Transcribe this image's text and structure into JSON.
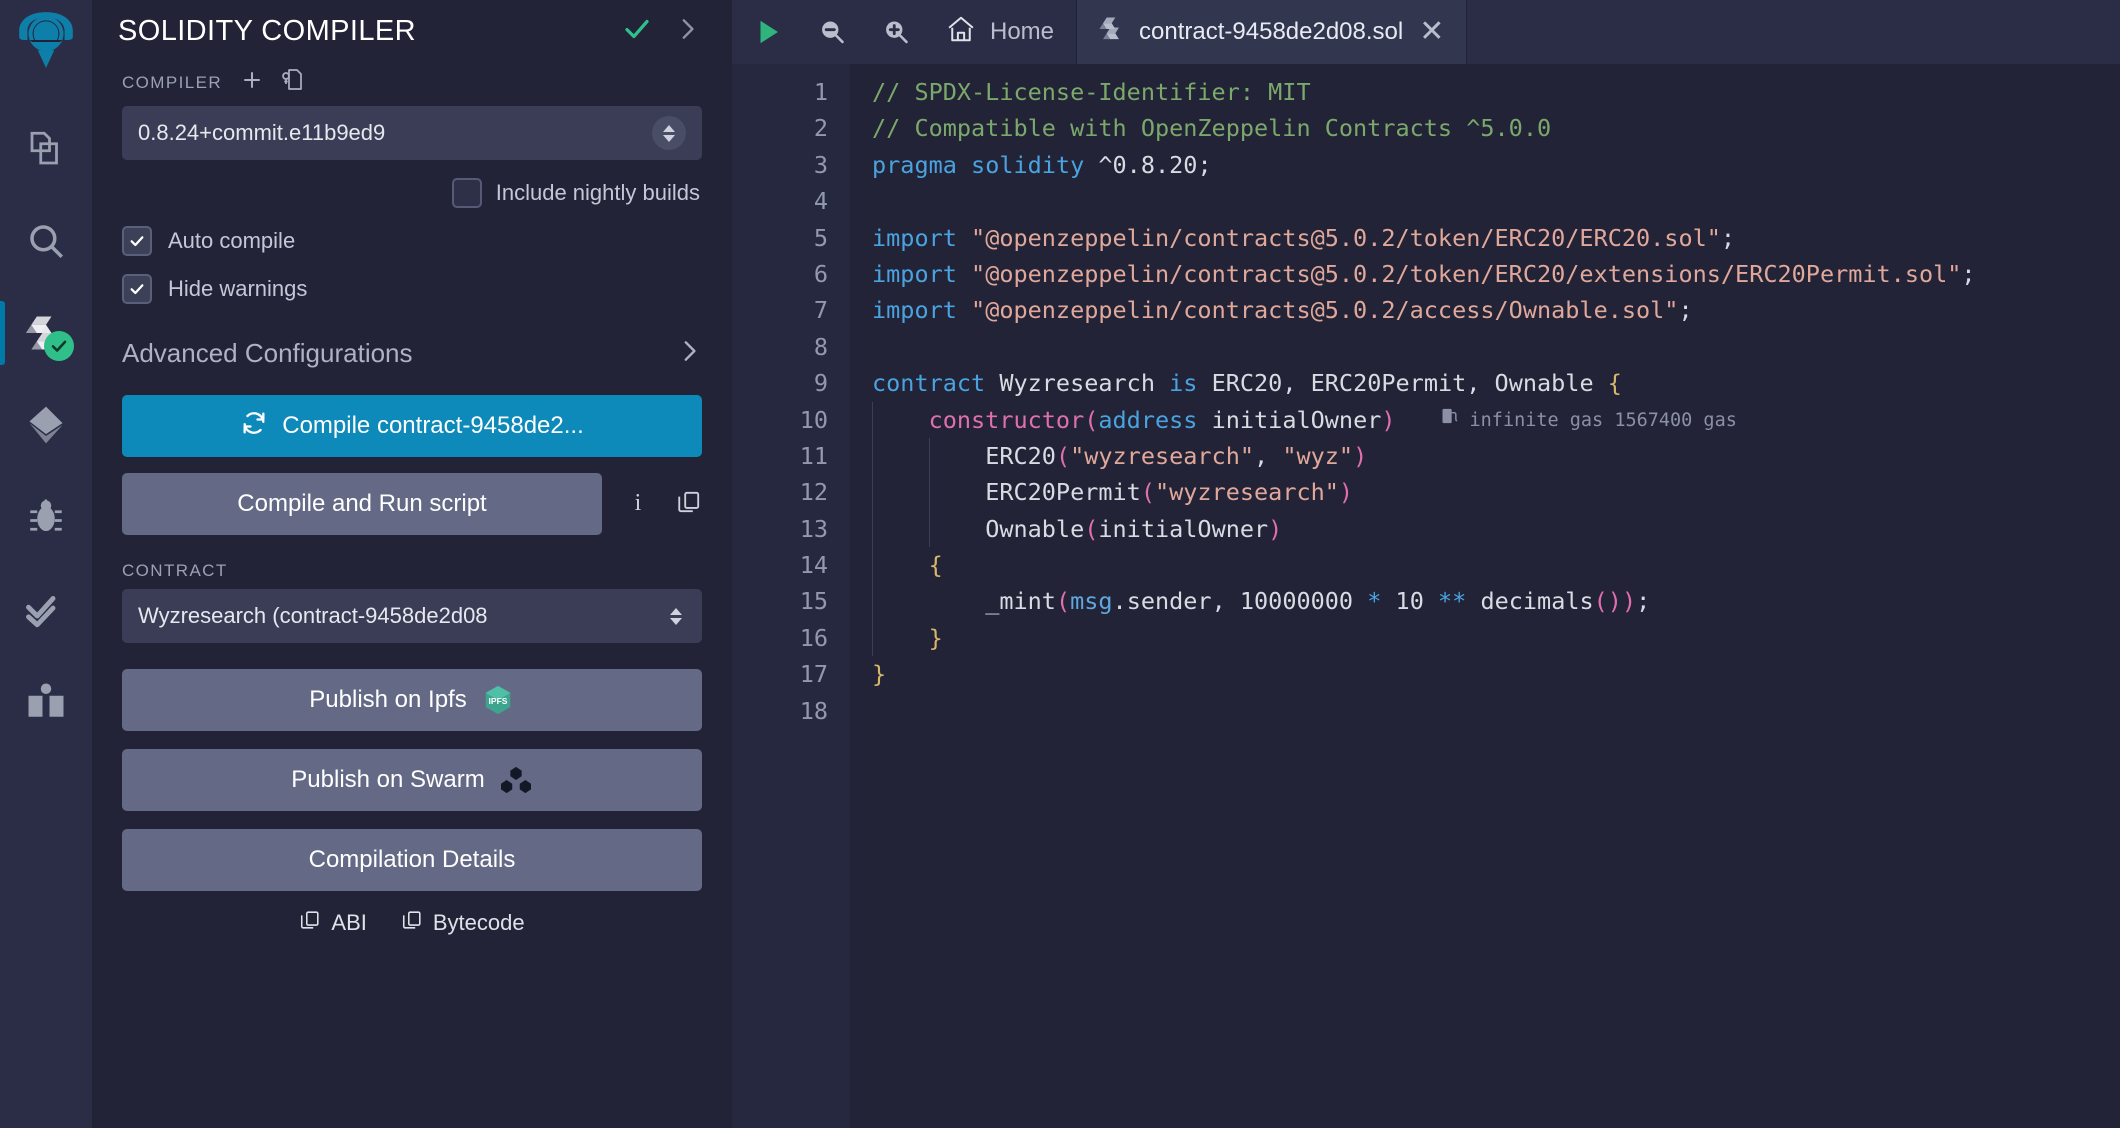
{
  "iconbar": {
    "items": [
      {
        "name": "remix-logo",
        "label": "Remix"
      },
      {
        "name": "file-explorer",
        "label": "File explorer"
      },
      {
        "name": "search",
        "label": "Search in files"
      },
      {
        "name": "solidity-compiler",
        "label": "Solidity compiler",
        "active": true,
        "status": "ok"
      },
      {
        "name": "deploy-run",
        "label": "Deploy & run transactions"
      },
      {
        "name": "debugger",
        "label": "Debugger"
      },
      {
        "name": "solidity-analyzers",
        "label": "Solidity analyzers"
      },
      {
        "name": "learneth",
        "label": "Learneth"
      }
    ]
  },
  "panel": {
    "title": "SOLIDITY COMPILER",
    "compiler_label": "COMPILER",
    "compiler_version": "0.8.24+commit.e11b9ed9",
    "nightly_label": "Include nightly builds",
    "nightly_checked": false,
    "auto_compile_label": "Auto compile",
    "auto_compile_checked": true,
    "hide_warnings_label": "Hide warnings",
    "hide_warnings_checked": true,
    "advanced_label": "Advanced Configurations",
    "compile_button": "Compile contract-9458de2...",
    "compile_run_button": "Compile and Run script",
    "contract_label": "CONTRACT",
    "contract_value": "Wyzresearch (contract-9458de2d08",
    "publish_ipfs": "Publish on Ipfs",
    "publish_ipfs_badge": "IPFS",
    "publish_swarm": "Publish on Swarm",
    "compilation_details": "Compilation Details",
    "abi_label": "ABI",
    "bytecode_label": "Bytecode"
  },
  "editor": {
    "toolbar": {
      "run_title": "Run",
      "zoom_out_title": "Zoom out",
      "zoom_in_title": "Zoom in",
      "home_label": "Home"
    },
    "tab": {
      "filename": "contract-9458de2d08.sol",
      "close_glyph": "✕"
    },
    "gas_note": "infinite gas 1567400 gas",
    "lines": [
      {
        "n": "1",
        "tokens": [
          {
            "t": "com",
            "v": "// SPDX-License-Identifier: MIT"
          }
        ]
      },
      {
        "n": "2",
        "tokens": [
          {
            "t": "com",
            "v": "// Compatible with OpenZeppelin Contracts ^5.0.0"
          }
        ]
      },
      {
        "n": "3",
        "tokens": [
          {
            "t": "kw",
            "v": "pragma"
          },
          {
            "t": "pun",
            "v": " "
          },
          {
            "t": "kw",
            "v": "solidity"
          },
          {
            "t": "pun",
            "v": " "
          },
          {
            "t": "num",
            "v": "^0.8.20"
          },
          {
            "t": "pun",
            "v": ";"
          }
        ]
      },
      {
        "n": "4",
        "tokens": []
      },
      {
        "n": "5",
        "tokens": [
          {
            "t": "kw",
            "v": "import"
          },
          {
            "t": "pun",
            "v": " "
          },
          {
            "t": "str",
            "v": "\"@openzeppelin/contracts@5.0.2/token/ERC20/ERC20.sol\""
          },
          {
            "t": "pun",
            "v": ";"
          }
        ]
      },
      {
        "n": "6",
        "tokens": [
          {
            "t": "kw",
            "v": "import"
          },
          {
            "t": "pun",
            "v": " "
          },
          {
            "t": "str",
            "v": "\"@openzeppelin/contracts@5.0.2/token/ERC20/extensions/ERC20Permit.sol\""
          },
          {
            "t": "pun",
            "v": ";"
          }
        ]
      },
      {
        "n": "7",
        "tokens": [
          {
            "t": "kw",
            "v": "import"
          },
          {
            "t": "pun",
            "v": " "
          },
          {
            "t": "str",
            "v": "\"@openzeppelin/contracts@5.0.2/access/Ownable.sol\""
          },
          {
            "t": "pun",
            "v": ";"
          }
        ]
      },
      {
        "n": "8",
        "tokens": []
      },
      {
        "n": "9",
        "tokens": [
          {
            "t": "kw",
            "v": "contract"
          },
          {
            "t": "pun",
            "v": " "
          },
          {
            "t": "id",
            "v": "Wyzresearch"
          },
          {
            "t": "pun",
            "v": " "
          },
          {
            "t": "kw",
            "v": "is"
          },
          {
            "t": "pun",
            "v": " "
          },
          {
            "t": "id",
            "v": "ERC20, ERC20Permit, Ownable "
          },
          {
            "t": "brace",
            "v": "{"
          }
        ]
      },
      {
        "n": "10",
        "tokens": [
          {
            "t": "pun",
            "v": "    "
          },
          {
            "t": "fn",
            "v": "constructor"
          },
          {
            "t": "fn",
            "v": "("
          },
          {
            "t": "type",
            "v": "address"
          },
          {
            "t": "pun",
            "v": " "
          },
          {
            "t": "id",
            "v": "initialOwner"
          },
          {
            "t": "fn",
            "v": ")"
          }
        ],
        "gas": true
      },
      {
        "n": "11",
        "tokens": [
          {
            "t": "pun",
            "v": "        "
          },
          {
            "t": "id",
            "v": "ERC20"
          },
          {
            "t": "fn",
            "v": "("
          },
          {
            "t": "str",
            "v": "\"wyzresearch\""
          },
          {
            "t": "pun",
            "v": ", "
          },
          {
            "t": "str",
            "v": "\"wyz\""
          },
          {
            "t": "fn",
            "v": ")"
          }
        ]
      },
      {
        "n": "12",
        "tokens": [
          {
            "t": "pun",
            "v": "        "
          },
          {
            "t": "id",
            "v": "ERC20Permit"
          },
          {
            "t": "fn",
            "v": "("
          },
          {
            "t": "str",
            "v": "\"wyzresearch\""
          },
          {
            "t": "fn",
            "v": ")"
          }
        ]
      },
      {
        "n": "13",
        "tokens": [
          {
            "t": "pun",
            "v": "        "
          },
          {
            "t": "id",
            "v": "Ownable"
          },
          {
            "t": "fn",
            "v": "("
          },
          {
            "t": "id",
            "v": "initialOwner"
          },
          {
            "t": "fn",
            "v": ")"
          }
        ]
      },
      {
        "n": "14",
        "tokens": [
          {
            "t": "pun",
            "v": "    "
          },
          {
            "t": "brace",
            "v": "{"
          }
        ]
      },
      {
        "n": "15",
        "tokens": [
          {
            "t": "pun",
            "v": "        "
          },
          {
            "t": "id",
            "v": "_mint"
          },
          {
            "t": "fn",
            "v": "("
          },
          {
            "t": "var",
            "v": "msg"
          },
          {
            "t": "pun",
            "v": ".sender, "
          },
          {
            "t": "num",
            "v": "10000000"
          },
          {
            "t": "pun",
            "v": " "
          },
          {
            "t": "kw",
            "v": "*"
          },
          {
            "t": "pun",
            "v": " "
          },
          {
            "t": "num",
            "v": "10"
          },
          {
            "t": "pun",
            "v": " "
          },
          {
            "t": "kw",
            "v": "**"
          },
          {
            "t": "pun",
            "v": " "
          },
          {
            "t": "id",
            "v": "decimals"
          },
          {
            "t": "fn",
            "v": "()"
          },
          {
            "t": "fn",
            "v": ")"
          },
          {
            "t": "pun",
            "v": ";"
          }
        ]
      },
      {
        "n": "16",
        "tokens": [
          {
            "t": "pun",
            "v": "    "
          },
          {
            "t": "brace",
            "v": "}"
          }
        ]
      },
      {
        "n": "17",
        "tokens": [
          {
            "t": "brace",
            "v": "}"
          }
        ]
      },
      {
        "n": "18",
        "tokens": []
      }
    ]
  }
}
